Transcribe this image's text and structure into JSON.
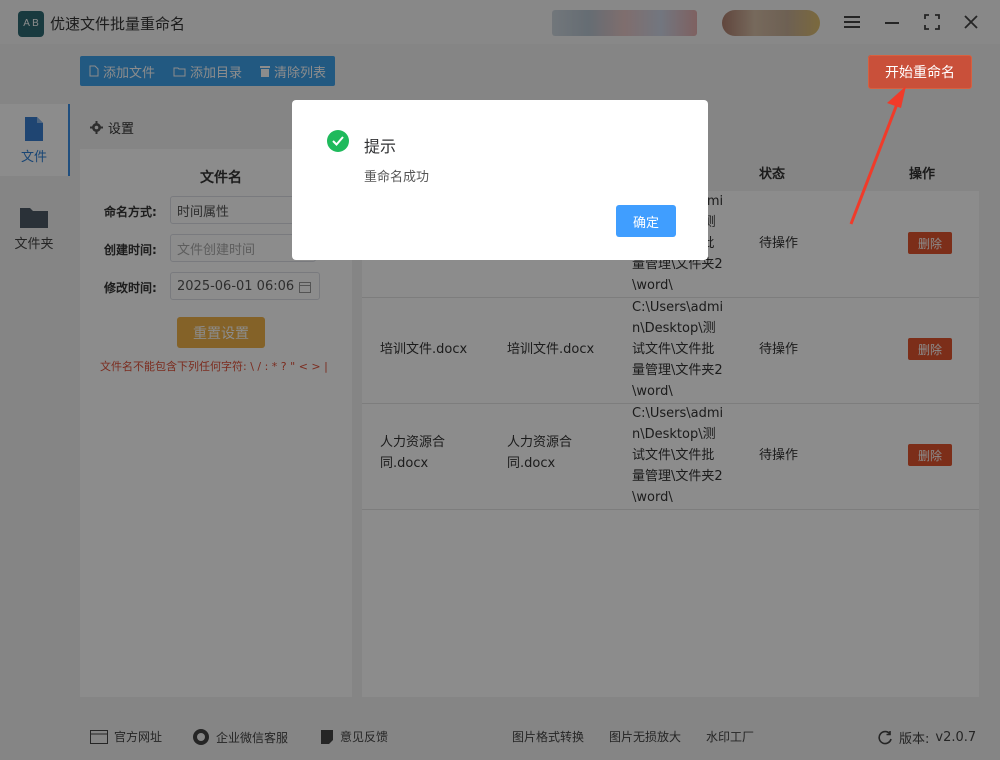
{
  "app": {
    "title": "优速文件批量重命名",
    "logo_text": "A B"
  },
  "toolbar": {
    "add_file": "添加文件",
    "add_dir": "添加目录",
    "clear_list": "清除列表",
    "start": "开始重命名"
  },
  "nav": {
    "file": "文件",
    "folder": "文件夹"
  },
  "settings": {
    "header": "设置",
    "section_title": "文件名",
    "mode_label": "命名方式:",
    "mode_value": "时间属性",
    "create_label": "创建时间:",
    "create_placeholder": "文件创建时间",
    "modify_label": "修改时间:",
    "modify_value": "2025-06-01 06:06",
    "reset": "重置设置",
    "warning": "文件名不能包含下列任何字符: \\ / : * ? \" < > |"
  },
  "table": {
    "headers": {
      "status": "状态",
      "action": "操作"
    },
    "rows": [
      {
        "orig": "",
        "new": "",
        "path": "C:\\Users\\admin\\Desktop\\测试文件\\文件批量管理\\文件夹2\\word\\",
        "status": "待操作",
        "action": "删除"
      },
      {
        "orig": "培训文件.docx",
        "new": "培训文件.docx",
        "path": "C:\\Users\\admin\\Desktop\\测试文件\\文件批量管理\\文件夹2\\word\\",
        "status": "待操作",
        "action": "删除"
      },
      {
        "orig": "人力资源合同.docx",
        "new": "人力资源合同.docx",
        "path": "C:\\Users\\admin\\Desktop\\测试文件\\文件批量管理\\文件夹2\\word\\",
        "status": "待操作",
        "action": "删除"
      }
    ]
  },
  "footer": {
    "website": "官方网址",
    "wechat": "企业微信客服",
    "feedback": "意见反馈",
    "img_convert": "图片格式转换",
    "img_enlarge": "图片无损放大",
    "watermark": "水印工厂",
    "version_label": "版本:",
    "version": "v2.0.7"
  },
  "modal": {
    "title": "提示",
    "message": "重命名成功",
    "ok": "确定"
  },
  "colors": {
    "accent": "#409eff",
    "start": "#ef6f4a",
    "delete": "#e2552f",
    "success": "#1fba5c",
    "toolbar": "#3fa3ec",
    "reset": "#f0b24a"
  }
}
